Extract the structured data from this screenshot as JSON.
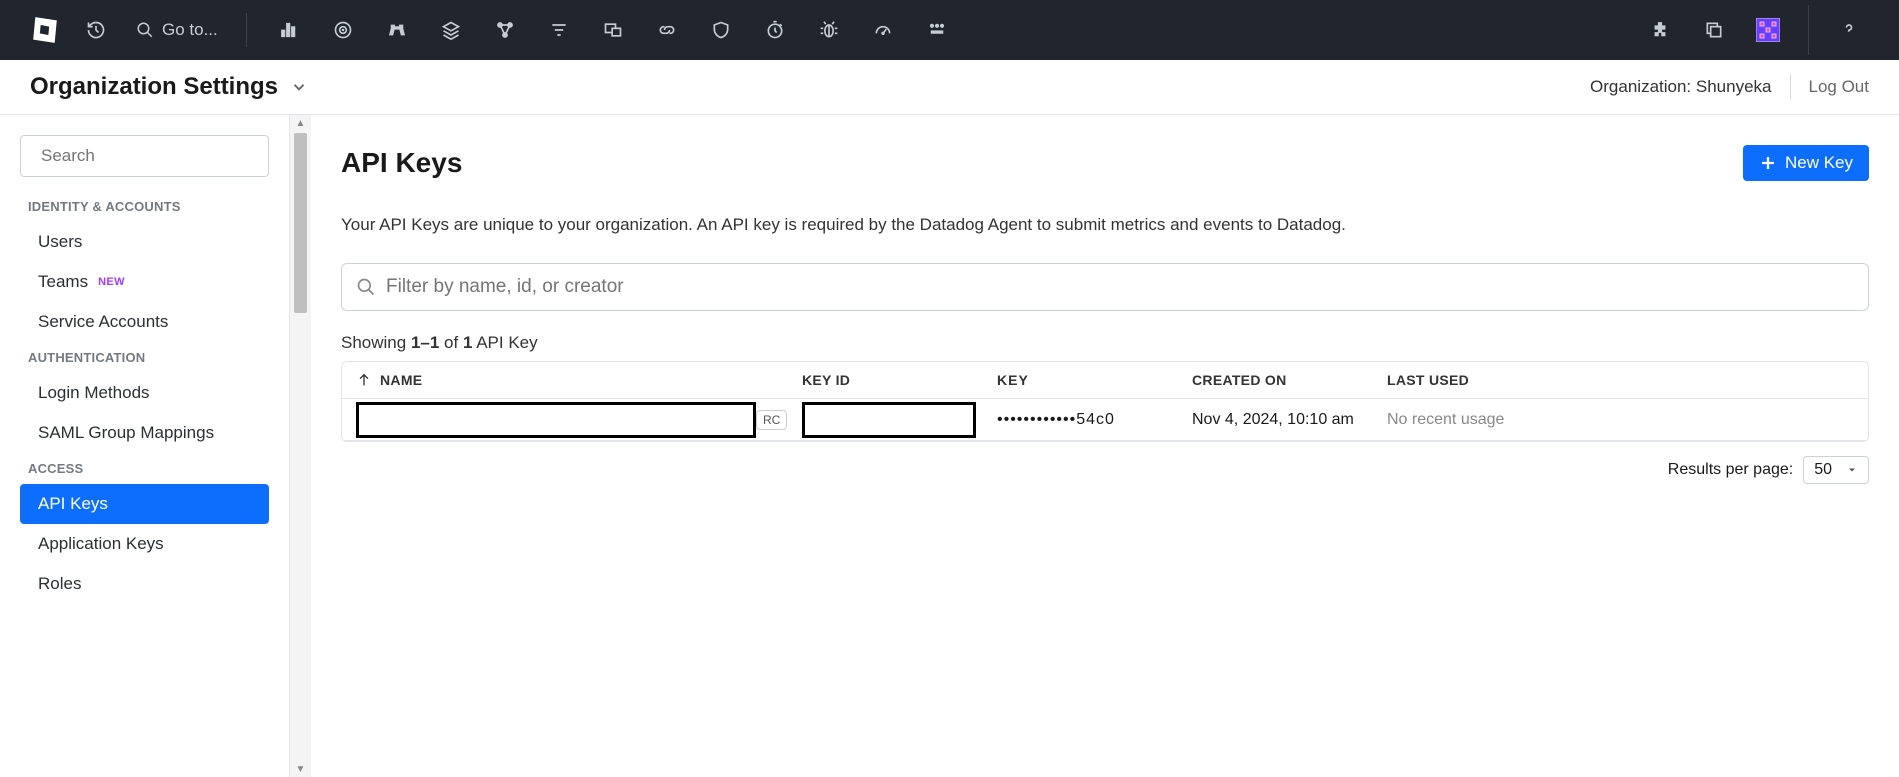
{
  "topnav": {
    "goto_label": "Go to..."
  },
  "subheader": {
    "title": "Organization Settings",
    "org_label": "Organization: Shunyeka",
    "logout": "Log Out"
  },
  "sidebar": {
    "search_placeholder": "Search",
    "groups": [
      {
        "label": "IDENTITY & ACCOUNTS",
        "items": [
          {
            "label": "Users"
          },
          {
            "label": "Teams",
            "badge": "NEW"
          },
          {
            "label": "Service Accounts"
          }
        ]
      },
      {
        "label": "AUTHENTICATION",
        "items": [
          {
            "label": "Login Methods"
          },
          {
            "label": "SAML Group Mappings"
          }
        ]
      },
      {
        "label": "ACCESS",
        "items": [
          {
            "label": "API Keys",
            "active": true
          },
          {
            "label": "Application Keys"
          },
          {
            "label": "Roles"
          }
        ]
      }
    ]
  },
  "content": {
    "title": "API Keys",
    "new_key_label": "New Key",
    "description": "Your API Keys are unique to your organization. An API key is required by the Datadog Agent to submit metrics and events to Datadog.",
    "filter_placeholder": "Filter by name, id, or creator",
    "showing_prefix": "Showing ",
    "showing_range": "1–1",
    "showing_mid": " of ",
    "showing_total": "1",
    "showing_suffix": " API Key",
    "columns": {
      "name": "NAME",
      "keyid": "KEY ID",
      "key": "KEY",
      "created": "CREATED ON",
      "last": "LAST USED"
    },
    "row": {
      "rc_suffix": "RC",
      "key_masked": "••••••••••••54c0",
      "created": "Nov 4, 2024, 10:10 am",
      "last_used": "No recent usage"
    },
    "pager": {
      "label": "Results per page:",
      "value": "50"
    }
  }
}
